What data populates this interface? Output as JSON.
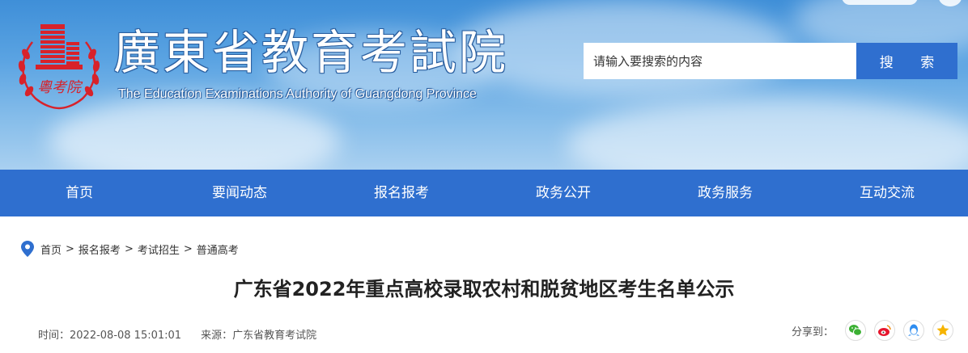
{
  "header": {
    "title": "廣東省教育考試院",
    "subtitle": "The Education Examinations Authority of Guangdong Province",
    "logo_text": "粵考院"
  },
  "search": {
    "placeholder": "请输入要搜索的内容",
    "button_label": "搜 索"
  },
  "nav": {
    "items": [
      {
        "label": "首页"
      },
      {
        "label": "要闻动态"
      },
      {
        "label": "报名报考"
      },
      {
        "label": "政务公开"
      },
      {
        "label": "政务服务"
      },
      {
        "label": "互动交流"
      }
    ]
  },
  "breadcrumb": {
    "items": [
      "首页",
      "报名报考",
      "考试招生",
      "普通高考"
    ],
    "separator": ">"
  },
  "article": {
    "title": "广东省2022年重点高校录取农村和脱贫地区考生名单公示",
    "time": "时间：2022-08-08 15:01:01",
    "source": "来源：广东省教育考试院"
  },
  "share": {
    "label": "分享到：",
    "icons": [
      "wechat-icon",
      "weibo-icon",
      "qq-icon",
      "qzone-icon"
    ]
  },
  "colors": {
    "brand_blue": "#2f6fcf",
    "logo_red": "#d8222a",
    "wechat_green": "#3cb034",
    "weibo_red": "#e6162d",
    "qq_blue": "#2d8cf0",
    "qzone_yellow": "#f6b400"
  }
}
